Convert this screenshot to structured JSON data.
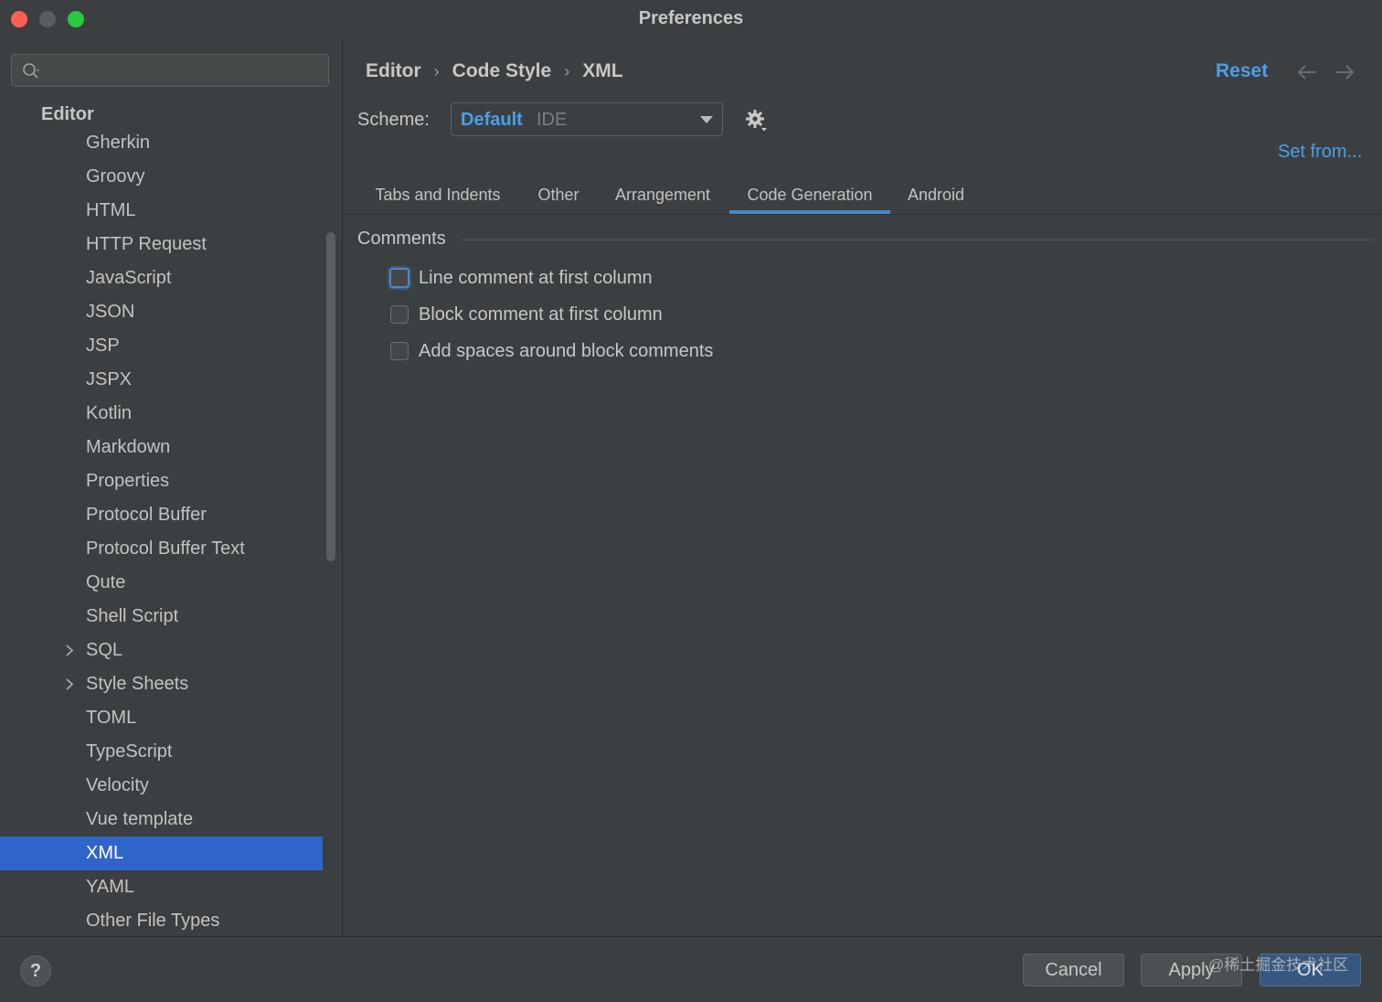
{
  "window": {
    "title": "Preferences"
  },
  "sidebar": {
    "search": {
      "value": "",
      "placeholder": ""
    },
    "root_label": "Editor",
    "items": [
      {
        "label": "Gherkin",
        "expandable": false,
        "selected": false
      },
      {
        "label": "Groovy",
        "expandable": false,
        "selected": false
      },
      {
        "label": "HTML",
        "expandable": false,
        "selected": false
      },
      {
        "label": "HTTP Request",
        "expandable": false,
        "selected": false
      },
      {
        "label": "JavaScript",
        "expandable": false,
        "selected": false
      },
      {
        "label": "JSON",
        "expandable": false,
        "selected": false
      },
      {
        "label": "JSP",
        "expandable": false,
        "selected": false
      },
      {
        "label": "JSPX",
        "expandable": false,
        "selected": false
      },
      {
        "label": "Kotlin",
        "expandable": false,
        "selected": false
      },
      {
        "label": "Markdown",
        "expandable": false,
        "selected": false
      },
      {
        "label": "Properties",
        "expandable": false,
        "selected": false
      },
      {
        "label": "Protocol Buffer",
        "expandable": false,
        "selected": false
      },
      {
        "label": "Protocol Buffer Text",
        "expandable": false,
        "selected": false
      },
      {
        "label": "Qute",
        "expandable": false,
        "selected": false
      },
      {
        "label": "Shell Script",
        "expandable": false,
        "selected": false
      },
      {
        "label": "SQL",
        "expandable": true,
        "selected": false
      },
      {
        "label": "Style Sheets",
        "expandable": true,
        "selected": false
      },
      {
        "label": "TOML",
        "expandable": false,
        "selected": false
      },
      {
        "label": "TypeScript",
        "expandable": false,
        "selected": false
      },
      {
        "label": "Velocity",
        "expandable": false,
        "selected": false
      },
      {
        "label": "Vue template",
        "expandable": false,
        "selected": false
      },
      {
        "label": "XML",
        "expandable": false,
        "selected": true
      },
      {
        "label": "YAML",
        "expandable": false,
        "selected": false
      },
      {
        "label": "Other File Types",
        "expandable": false,
        "selected": false
      }
    ]
  },
  "header": {
    "breadcrumb": [
      "Editor",
      "Code Style",
      "XML"
    ],
    "reset_label": "Reset",
    "back_icon": "arrow-left-icon",
    "forward_icon": "arrow-right-icon"
  },
  "scheme": {
    "label": "Scheme:",
    "name": "Default",
    "type": "IDE",
    "gear_icon": "gear-icon",
    "set_from_label": "Set from..."
  },
  "tabs": [
    {
      "label": "Tabs and Indents",
      "active": false
    },
    {
      "label": "Other",
      "active": false
    },
    {
      "label": "Arrangement",
      "active": false
    },
    {
      "label": "Code Generation",
      "active": true
    },
    {
      "label": "Android",
      "active": false
    }
  ],
  "comments": {
    "title": "Comments",
    "options": [
      {
        "label": "Line comment at first column",
        "checked": false,
        "focused": true
      },
      {
        "label": "Block comment at first column",
        "checked": false,
        "focused": false
      },
      {
        "label": "Add spaces around block comments",
        "checked": false,
        "focused": false
      }
    ]
  },
  "footer": {
    "help_label": "?",
    "cancel_label": "Cancel",
    "apply_label": "Apply",
    "ok_label": "OK",
    "watermark": "@稀土掘金技术社区"
  },
  "colors": {
    "background": "#3c3f41",
    "accent": "#4a9fe9",
    "selection": "#2f65ca",
    "tab_underline": "#4a88c7",
    "close": "#ff5f57",
    "maximize": "#28c840"
  }
}
